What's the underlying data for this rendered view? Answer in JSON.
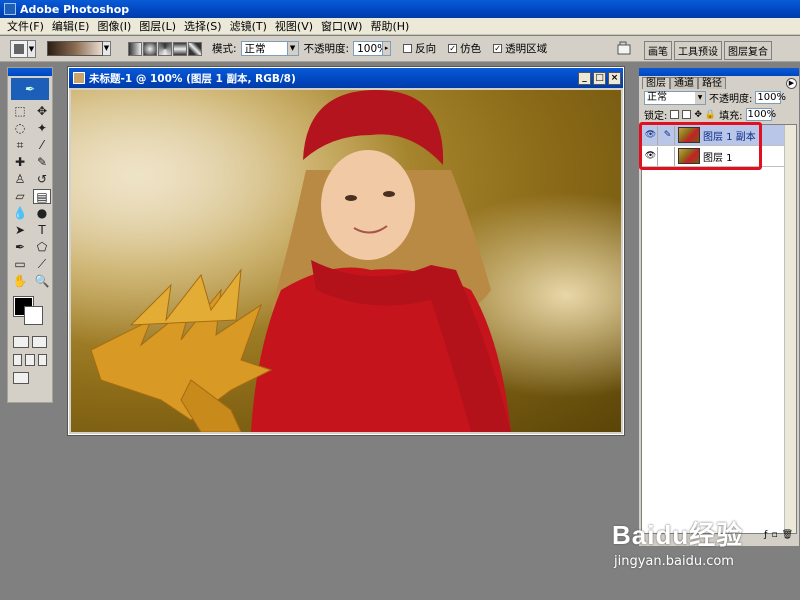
{
  "app": {
    "title": "Adobe Photoshop"
  },
  "menu": [
    "文件(F)",
    "编辑(E)",
    "图像(I)",
    "图层(L)",
    "选择(S)",
    "滤镜(T)",
    "视图(V)",
    "窗口(W)",
    "帮助(H)"
  ],
  "options": {
    "mode_label": "模式:",
    "mode_value": "正常",
    "opacity_label": "不透明度:",
    "opacity_value": "100%",
    "reverse_label": "反向",
    "dither_label": "仿色",
    "transparency_label": "透明区域"
  },
  "palette_well": {
    "tabs": [
      "画笔",
      "工具预设",
      "图层复合"
    ]
  },
  "document": {
    "title": "未标题-1 @ 100% (图层 1 副本, RGB/8)",
    "win_buttons": [
      "_",
      "□",
      "×"
    ]
  },
  "layers_panel": {
    "tabs": [
      "图层",
      "通道",
      "路径"
    ],
    "blend_mode": "正常",
    "opacity_label": "不透明度:",
    "opacity_value": "100%",
    "lock_label": "锁定:",
    "fill_label": "填充:",
    "fill_value": "100%",
    "layers": [
      {
        "name": "图层 1 副本",
        "selected": true
      },
      {
        "name": "图层 1",
        "selected": false
      }
    ]
  },
  "watermark": {
    "logo": "Baidu经验",
    "url": "jingyan.baidu.com"
  },
  "colors": {
    "highlight": "#e01020",
    "titlebar": "#0046c0"
  }
}
